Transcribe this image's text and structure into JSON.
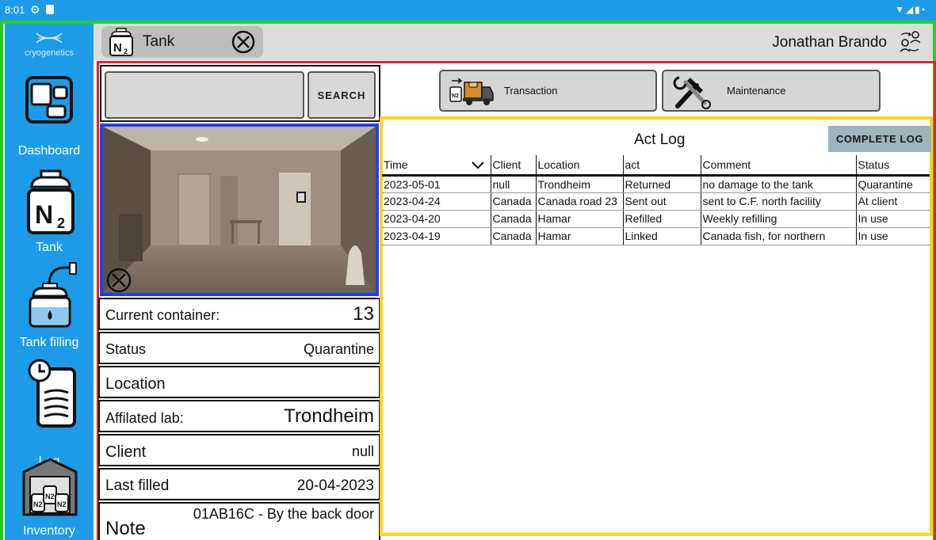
{
  "status_bar": {
    "time": "8:01"
  },
  "app": {
    "logo_text": "cryogenetics",
    "brand_color": "#1e9be8"
  },
  "sidebar": {
    "items": [
      {
        "label": "Dashboard",
        "icon": "dashboard-icon"
      },
      {
        "label": "Tank",
        "icon": "n2-tank-icon"
      },
      {
        "label": "Tank filling",
        "icon": "tank-filling-icon"
      },
      {
        "label": "Log",
        "icon": "clock-log-icon"
      },
      {
        "label": "Inventory",
        "icon": "warehouse-icon"
      }
    ]
  },
  "header": {
    "tab_label": "Tank",
    "user_name": "Jonathan Brando"
  },
  "search": {
    "value": "",
    "button_label": "SEARCH"
  },
  "actions": {
    "transaction_label": "Transaction",
    "maintenance_label": "Maintenance"
  },
  "tank_info": {
    "current_container": {
      "key": "Current container:",
      "value": "13"
    },
    "status": {
      "key": "Status",
      "value": "Quarantine"
    },
    "location": {
      "key": "Location",
      "value": ""
    },
    "affiliated_lab": {
      "key": "Affilated lab:",
      "value": "Trondheim"
    },
    "client": {
      "key": "Client",
      "value": "null"
    },
    "last_filled": {
      "key": "Last filled",
      "value": "20-04-2023"
    },
    "note": {
      "key": "Note",
      "value": "01AB16C - By the back door"
    }
  },
  "log": {
    "title": "Act Log",
    "complete_button": "COMPLETE LOG",
    "columns": [
      "Time",
      "Client",
      "Location",
      "act",
      "Comment",
      "Status"
    ],
    "rows": [
      [
        "2023-05-01",
        "null",
        "Trondheim",
        "Returned",
        "no damage to the tank",
        "Quarantine"
      ],
      [
        "2023-04-24",
        "Canada",
        "Canada road 23",
        "Sent out",
        "sent to C.F. north facility",
        "At client"
      ],
      [
        "2023-04-20",
        "Canada",
        "Hamar",
        "Refilled",
        "Weekly refilling",
        "In use"
      ],
      [
        "2023-04-19",
        "Canada",
        "Hamar",
        "Linked",
        "Canada fish, for northern",
        "In use"
      ]
    ]
  }
}
